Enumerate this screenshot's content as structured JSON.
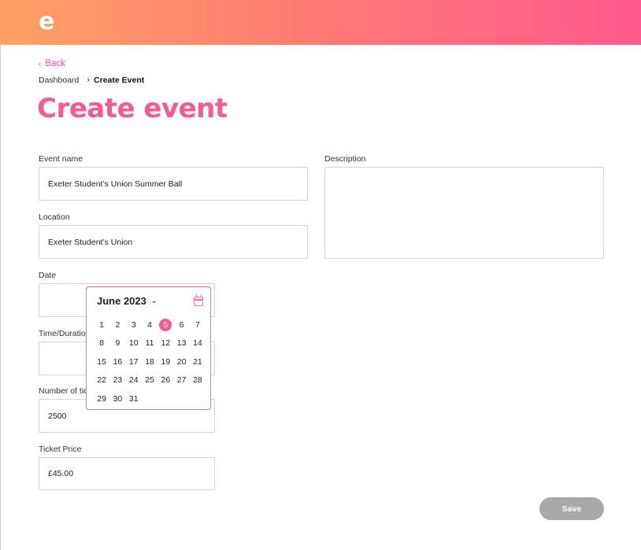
{
  "header": {
    "logo_text": "e",
    "gradient": [
      "#ffa164",
      "#ff5a8f"
    ]
  },
  "nav": {
    "back_label": "Back",
    "back_chevron": "‹"
  },
  "breadcrumb": {
    "items": [
      "Dashboard",
      "Create Event"
    ],
    "separator": "›"
  },
  "page": {
    "title": "Create event",
    "accent": "#f65a93"
  },
  "form": {
    "event_name": {
      "label": "Event name",
      "value": "Exeter Student’s Union Summer Ball"
    },
    "location": {
      "label": "Location",
      "value": "Exeter Student’s Union"
    },
    "date": {
      "label": "Date",
      "value": ""
    },
    "time_duration": {
      "label": "Time/Duration",
      "value": ""
    },
    "tickets": {
      "label": "Number of tickets",
      "value": "2500"
    },
    "ticket_price": {
      "label": "Ticket Price",
      "value": "£45.00"
    },
    "description": {
      "label": "Description",
      "value": ""
    },
    "save_label": "Save"
  },
  "calendar": {
    "month_label": "June 2023",
    "chevron": "⌄",
    "icon": "calendar-icon",
    "days": [
      "1",
      "2",
      "3",
      "4",
      "5",
      "6",
      "7",
      "8",
      "9",
      "10",
      "11",
      "12",
      "13",
      "14",
      "15",
      "16",
      "17",
      "18",
      "19",
      "20",
      "21",
      "22",
      "23",
      "24",
      "25",
      "26",
      "27",
      "28",
      "29",
      "30",
      "31"
    ],
    "selected": "5"
  }
}
